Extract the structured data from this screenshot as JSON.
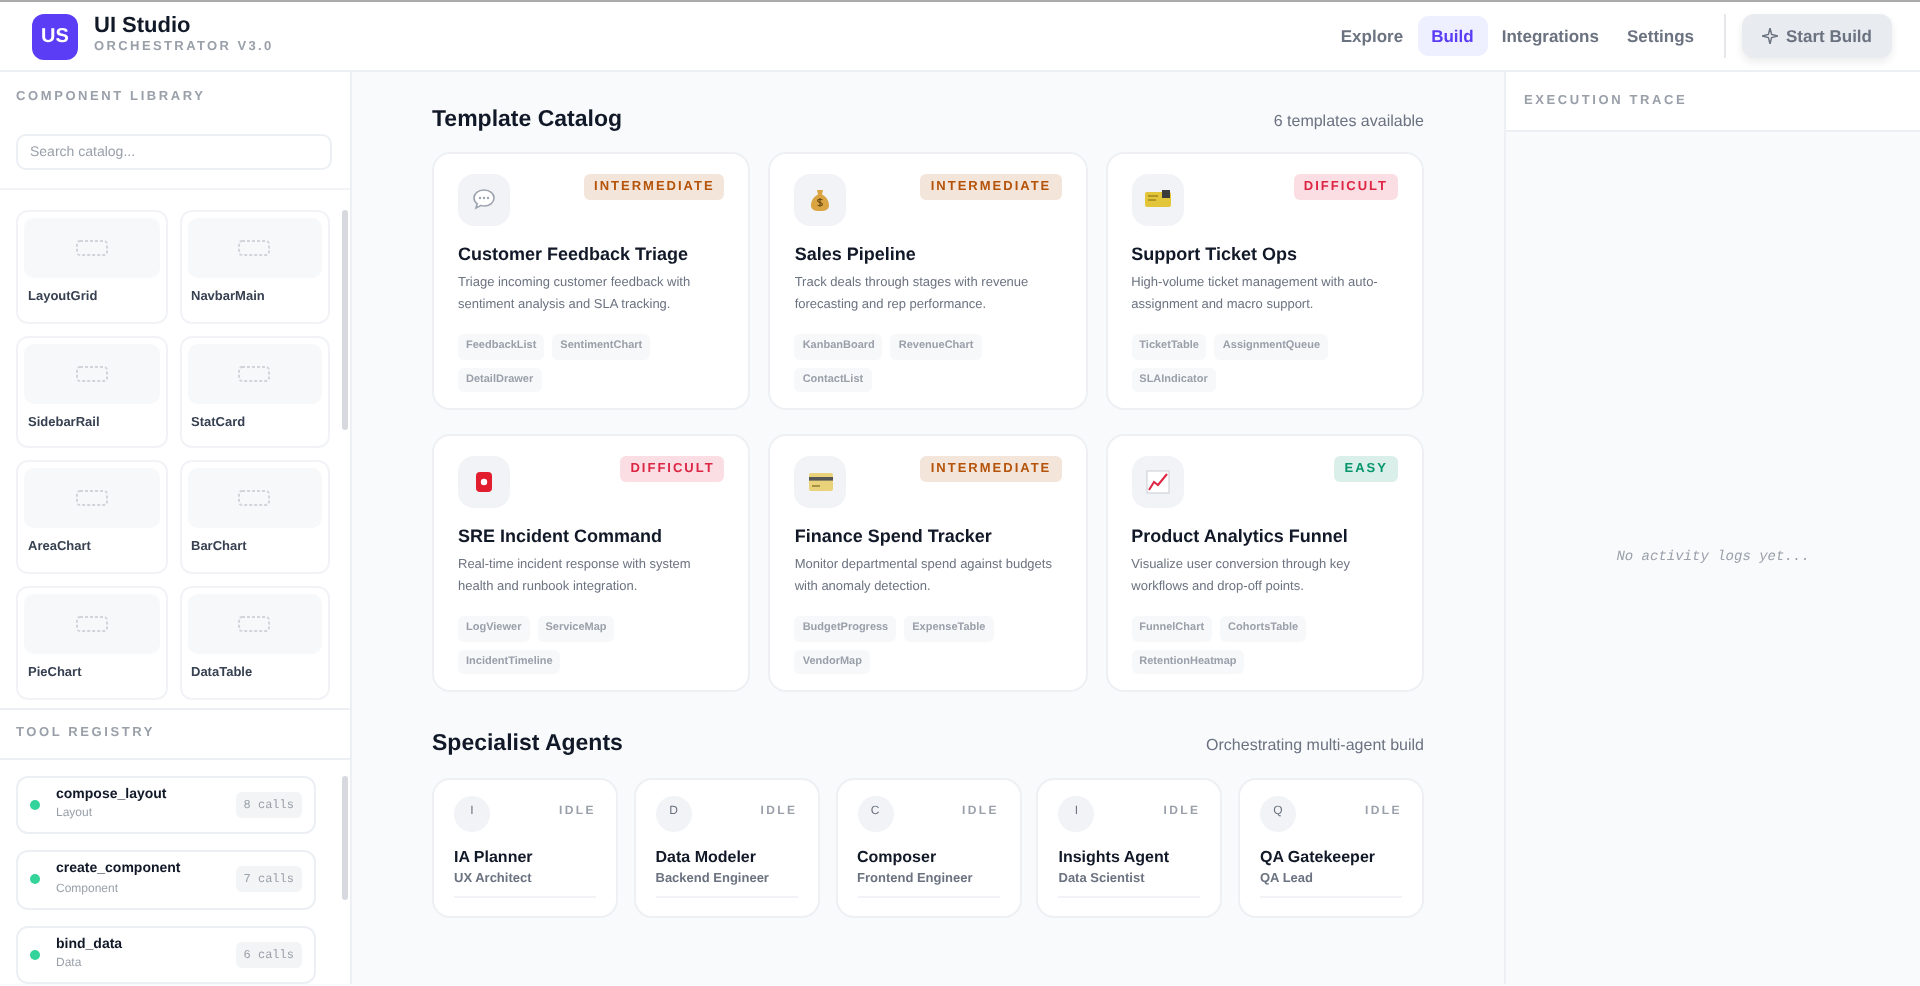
{
  "app": {
    "logo": "US",
    "title": "UI Studio",
    "subtitle": "ORCHESTRATOR V3.0"
  },
  "nav": [
    {
      "label": "Explore",
      "selected": false
    },
    {
      "label": "Build",
      "selected": true
    },
    {
      "label": "Integrations",
      "selected": false
    },
    {
      "label": "Settings",
      "selected": false
    }
  ],
  "start_button": "Start Build",
  "component_library": {
    "title": "COMPONENT LIBRARY",
    "search": {
      "placeholder": "Search catalog..."
    },
    "items": [
      "LayoutGrid",
      "NavbarMain",
      "SidebarRail",
      "StatCard",
      "AreaChart",
      "BarChart",
      "PieChart",
      "DataTable"
    ]
  },
  "tool_registry": {
    "title": "TOOL REGISTRY",
    "tools": [
      {
        "name": "compose_layout",
        "category": "Layout",
        "calls": "8 calls",
        "color": "#34d399"
      },
      {
        "name": "create_component",
        "category": "Component",
        "calls": "7 calls",
        "color": "#34d399"
      },
      {
        "name": "bind_data",
        "category": "Data",
        "calls": "6 calls",
        "color": "#34d399"
      }
    ]
  },
  "template_catalog": {
    "title": "Template Catalog",
    "count": "6 templates available",
    "templates": [
      {
        "badge": "INTERMEDIATE",
        "color": "#b45309",
        "title": "Customer Feedback Triage",
        "description": "Triage incoming customer feedback with sentiment analysis and SLA tracking.",
        "tags": [
          "FeedbackList",
          "SentimentChart",
          "DetailDrawer"
        ]
      },
      {
        "badge": "INTERMEDIATE",
        "color": "#b45309",
        "title": "Sales Pipeline",
        "description": "Track deals through stages with revenue forecasting and rep performance.",
        "tags": [
          "KanbanBoard",
          "RevenueChart",
          "ContactList"
        ]
      },
      {
        "badge": "DIFFICULT",
        "color": "#dc2644",
        "title": "Support Ticket Ops",
        "description": "High-volume ticket management with auto-assignment and macro support.",
        "tags": [
          "TicketTable",
          "AssignmentQueue",
          "SLAIndicator"
        ]
      },
      {
        "badge": "DIFFICULT",
        "color": "#dc2644",
        "title": "SRE Incident Command",
        "description": "Real-time incident response with system health and runbook integration.",
        "tags": [
          "LogViewer",
          "ServiceMap",
          "IncidentTimeline"
        ]
      },
      {
        "badge": "INTERMEDIATE",
        "color": "#b45309",
        "title": "Finance Spend Tracker",
        "description": "Monitor departmental spend against budgets with anomaly detection.",
        "tags": [
          "BudgetProgress",
          "ExpenseTable",
          "VendorMap"
        ]
      },
      {
        "badge": "EASY",
        "color": "#059669",
        "title": "Product Analytics Funnel",
        "description": "Visualize user conversion through key workflows and drop-off points.",
        "tags": [
          "FunnelChart",
          "CohortsTable",
          "RetentionHeatmap"
        ]
      }
    ]
  },
  "agents": {
    "title": "Specialist Agents",
    "subtitle": "Orchestrating multi-agent build",
    "items": [
      {
        "initial": "I",
        "status": "IDLE",
        "name": "IA Planner",
        "role": "UX Architect"
      },
      {
        "initial": "D",
        "status": "IDLE",
        "name": "Data Modeler",
        "role": "Backend Engineer"
      },
      {
        "initial": "C",
        "status": "IDLE",
        "name": "Composer",
        "role": "Frontend Engineer"
      },
      {
        "initial": "I",
        "status": "IDLE",
        "name": "Insights Agent",
        "role": "Data Scientist"
      },
      {
        "initial": "Q",
        "status": "IDLE",
        "name": "QA Gatekeeper",
        "role": "QA Lead"
      }
    ]
  },
  "execution_trace": {
    "title": "EXECUTION TRACE",
    "empty_message": "No activity logs yet..."
  }
}
